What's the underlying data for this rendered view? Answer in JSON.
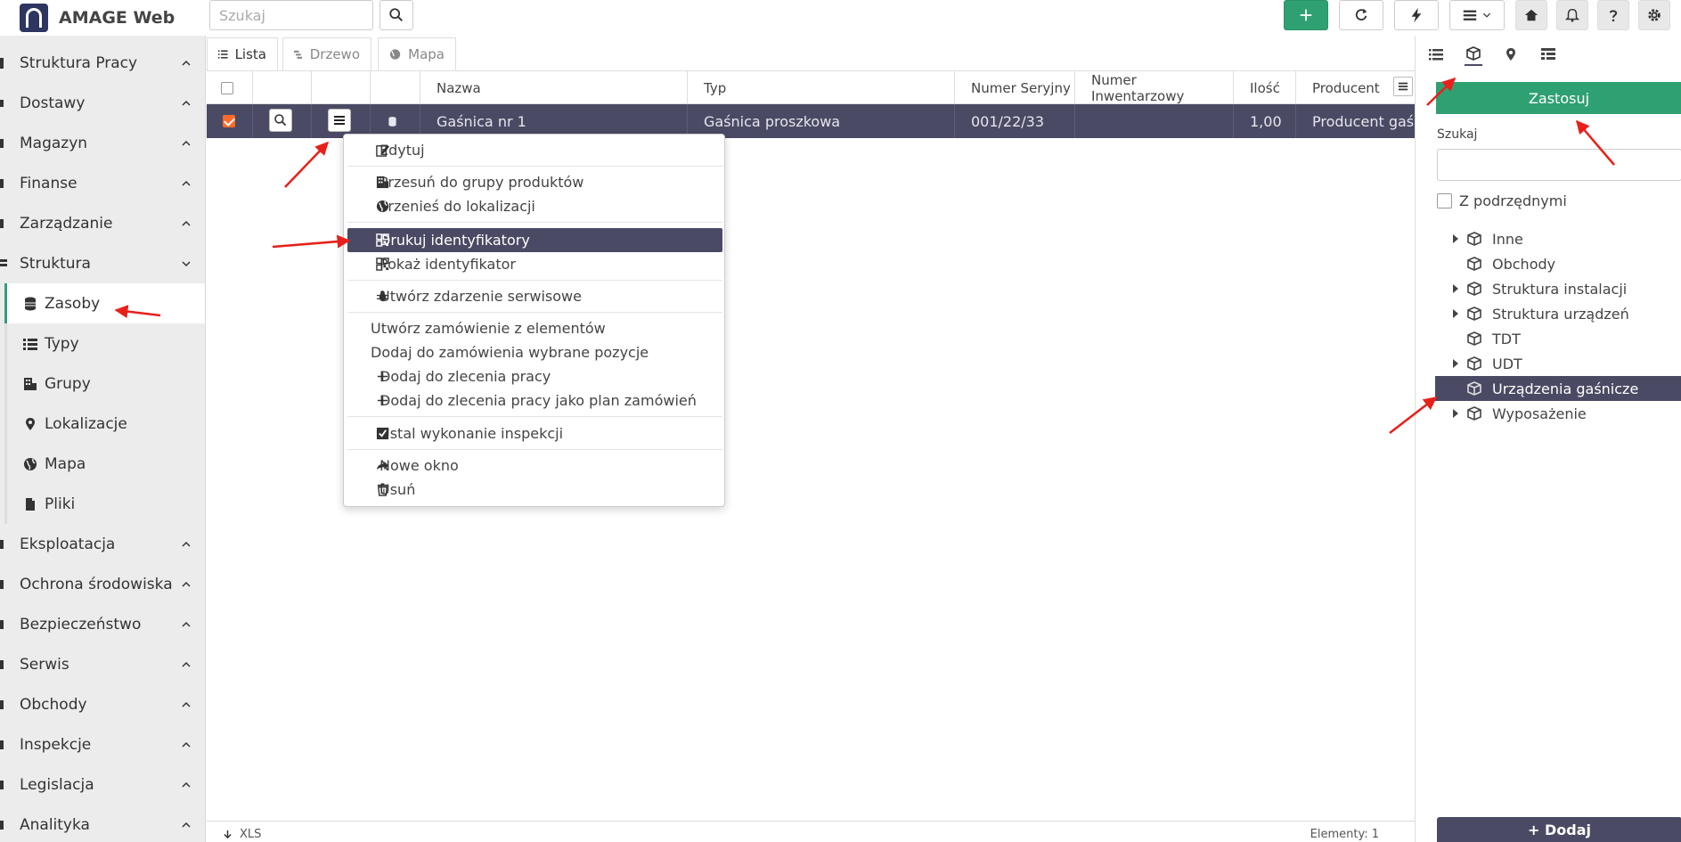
{
  "app": {
    "title": "AMAGE Web"
  },
  "toolbar": {
    "search_placeholder": "Szukaj"
  },
  "sidebar": {
    "items": [
      {
        "label": "Struktura Pracy"
      },
      {
        "label": "Dostawy"
      },
      {
        "label": "Magazyn"
      },
      {
        "label": "Finanse"
      },
      {
        "label": "Zarządzanie"
      },
      {
        "label": "Struktura"
      },
      {
        "label": "Eksploatacja"
      },
      {
        "label": "Ochrona środowiska"
      },
      {
        "label": "Bezpieczeństwo"
      },
      {
        "label": "Serwis"
      },
      {
        "label": "Obchody"
      },
      {
        "label": "Inspekcje"
      },
      {
        "label": "Legislacja"
      },
      {
        "label": "Analityka"
      }
    ],
    "sub_items": [
      {
        "label": "Zasoby"
      },
      {
        "label": "Typy"
      },
      {
        "label": "Grupy"
      },
      {
        "label": "Lokalizacje"
      },
      {
        "label": "Mapa"
      },
      {
        "label": "Pliki"
      }
    ]
  },
  "tabs": [
    {
      "label": "Lista"
    },
    {
      "label": "Drzewo"
    },
    {
      "label": "Mapa"
    }
  ],
  "table": {
    "columns": [
      "Nazwa",
      "Typ",
      "Numer Seryjny",
      "Numer Inwentarzowy",
      "Ilość",
      "Producent"
    ],
    "row": {
      "nazwa": "Gaśnica nr 1",
      "typ": "Gaśnica proszkowa",
      "numer_seryjny": "001/22/33",
      "numer_inwentarzowy": "",
      "ilosc": "1,00",
      "producent": "Producent gaśnic"
    }
  },
  "context_menu": {
    "items": [
      {
        "label": "Edytuj"
      },
      {
        "label": "Przesuń do grupy produktów"
      },
      {
        "label": "Przenieś do lokalizacji"
      },
      {
        "label": "Drukuj identyfikatory"
      },
      {
        "label": "Pokaż identyfikator"
      },
      {
        "label": "Utwórz zdarzenie serwisowe"
      },
      {
        "label": "Utwórz zamówienie z elementów"
      },
      {
        "label": "Dodaj do zamówienia wybrane pozycje"
      },
      {
        "label": "Dodaj do zlecenia pracy"
      },
      {
        "label": "Dodaj do zlecenia pracy jako plan zamówień"
      },
      {
        "label": "Ustal wykonanie inspekcji"
      },
      {
        "label": "Nowe okno"
      },
      {
        "label": "Usuń"
      }
    ]
  },
  "right_panel": {
    "apply_label": "Zastosuj",
    "search_label": "Szukaj",
    "include_children_label": "Z podrzędnymi",
    "tree": [
      {
        "label": "Inne"
      },
      {
        "label": "Obchody"
      },
      {
        "label": "Struktura instalacji"
      },
      {
        "label": "Struktura urządzeń"
      },
      {
        "label": "TDT"
      },
      {
        "label": "UDT"
      },
      {
        "label": "Urządzenia gaśnicze"
      },
      {
        "label": "Wyposażenie"
      }
    ],
    "add_label": "+ Dodaj"
  },
  "footer": {
    "export_label": "XLS",
    "count_label": "Elementy:  1"
  },
  "colors": {
    "accent_green": "#2fa072",
    "selection_dark": "#4a4a64",
    "checkbox_orange": "#ff6a2a",
    "annotation_red": "#e8201a"
  }
}
